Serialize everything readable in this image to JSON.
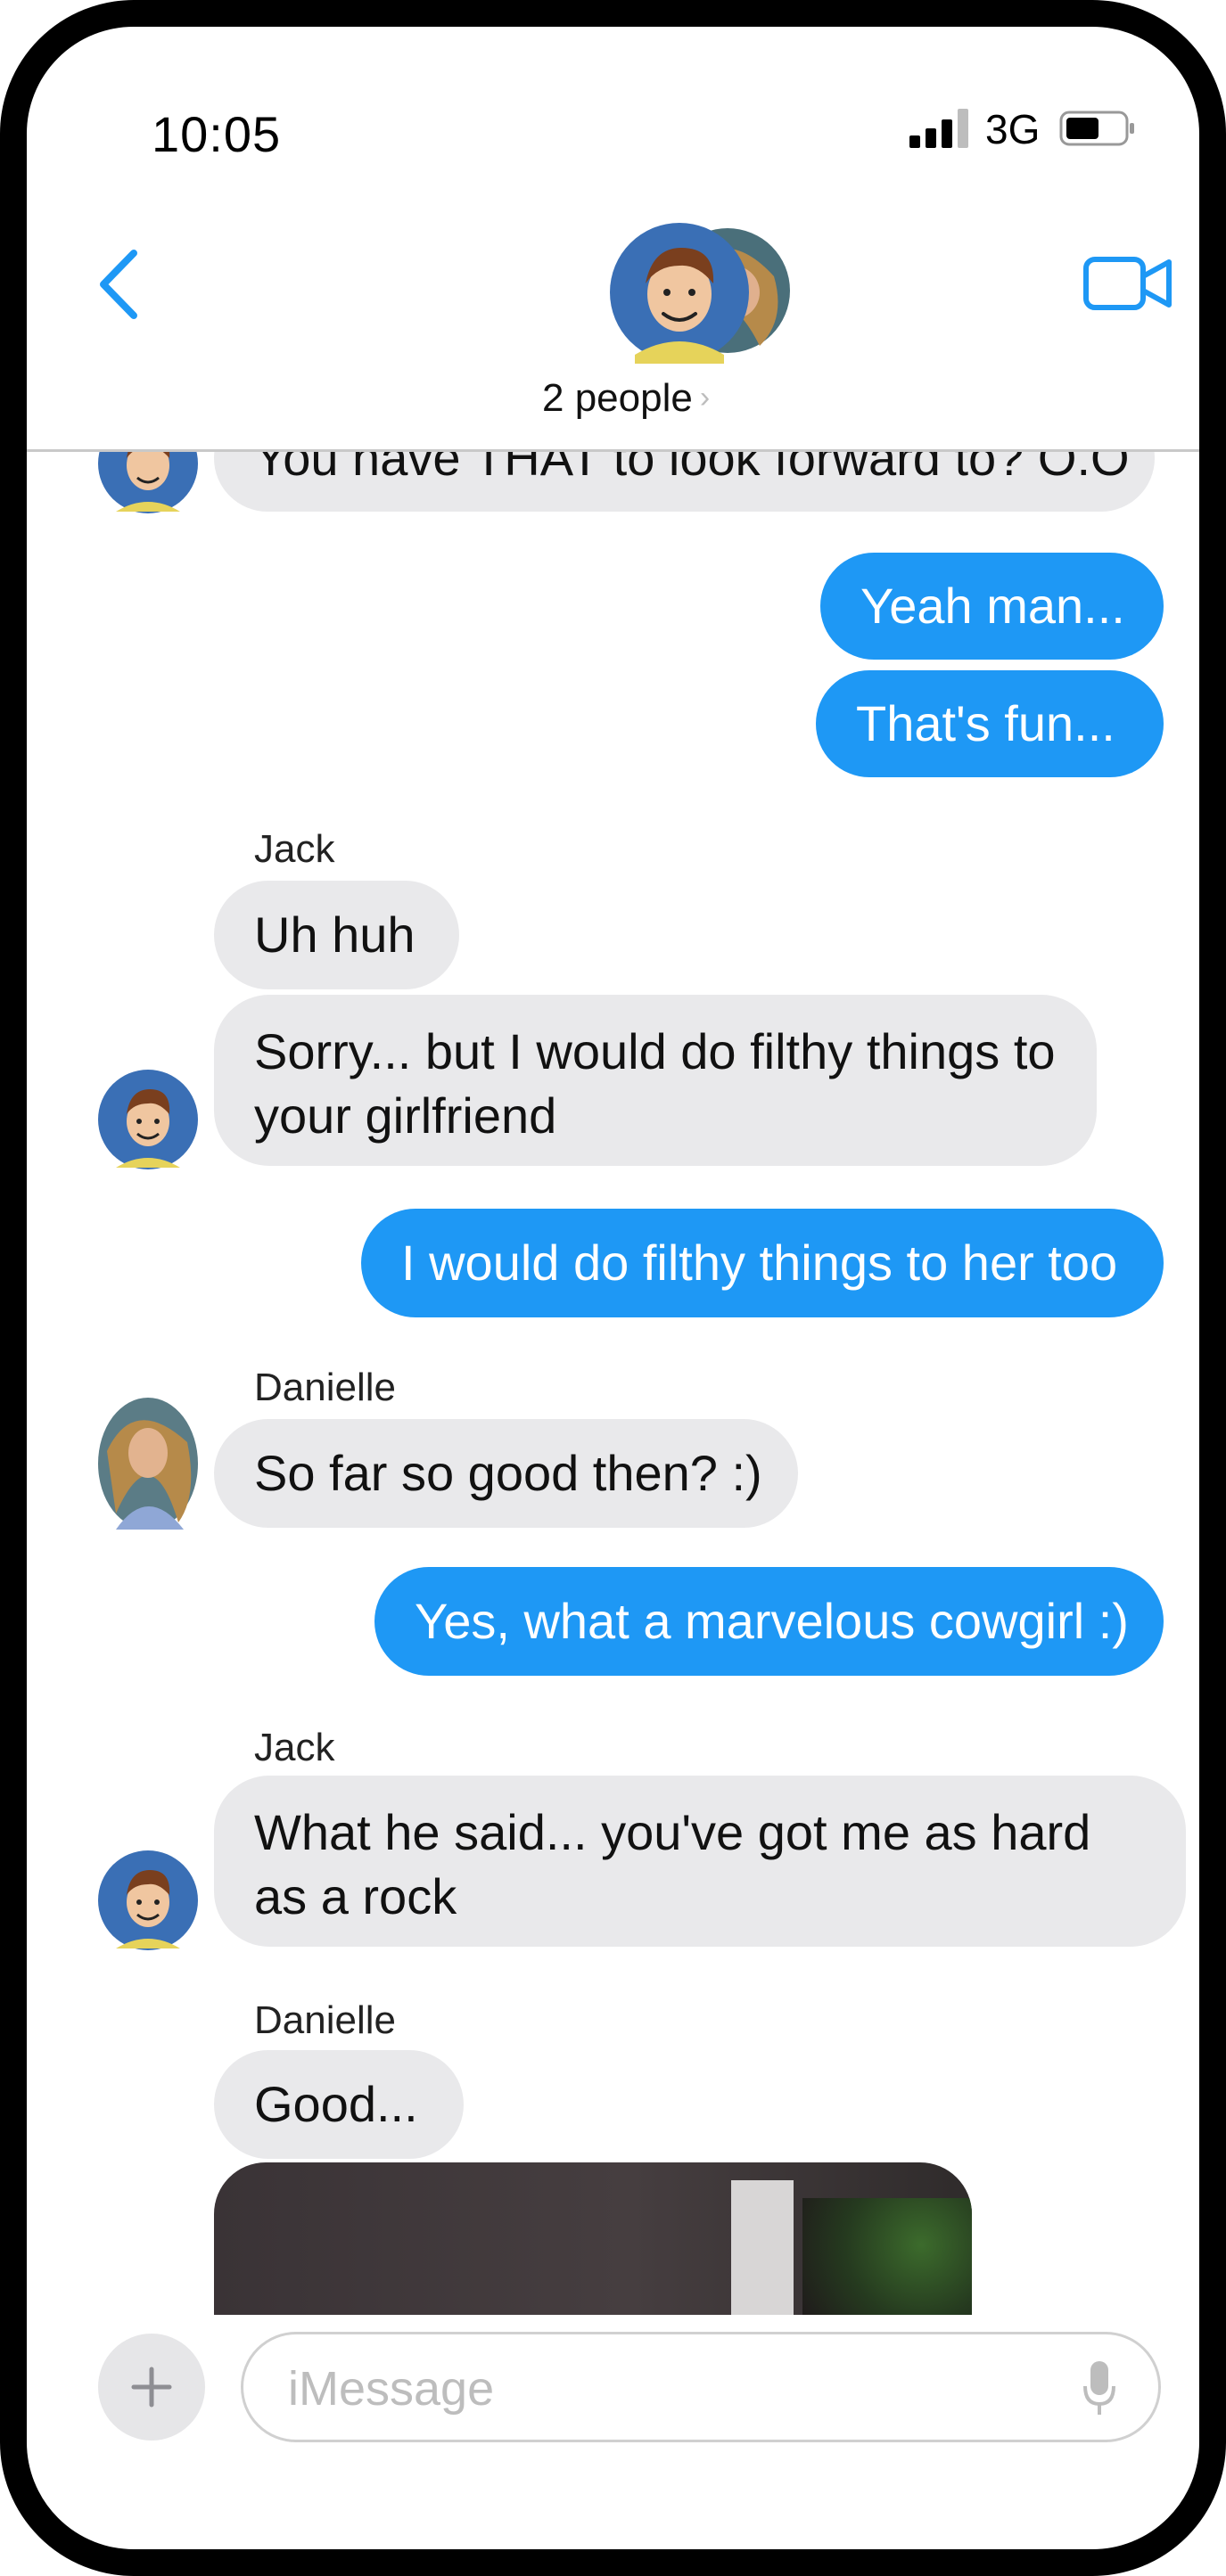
{
  "status_bar": {
    "time": "10:05",
    "network": "3G"
  },
  "header": {
    "people_label": "2 people",
    "chevron": "›"
  },
  "messages": [
    {
      "dir": "in",
      "sender": "",
      "text": "You have THAT to look forward to? O.O"
    },
    {
      "dir": "out",
      "text": "Yeah man..."
    },
    {
      "dir": "out",
      "text": "That's fun..."
    },
    {
      "dir": "in",
      "sender": "Jack",
      "text": "Uh huh"
    },
    {
      "dir": "in",
      "sender": "",
      "text": "Sorry... but I would do filthy things to your girlfriend"
    },
    {
      "dir": "out",
      "text": "I would do filthy things to her too"
    },
    {
      "dir": "in",
      "sender": "Danielle",
      "text": "So far so good then? :)"
    },
    {
      "dir": "out",
      "text": "Yes, what a marvelous cowgirl :)"
    },
    {
      "dir": "in",
      "sender": "Jack",
      "text": "What he said... you've got me as hard as a rock"
    },
    {
      "dir": "in",
      "sender": "Danielle",
      "text": "Good..."
    }
  ],
  "composer": {
    "placeholder": "iMessage"
  },
  "icons": {
    "back": "chevron-left-icon",
    "video": "video-camera-icon",
    "add": "plus-icon",
    "mic": "microphone-icon"
  },
  "colors": {
    "accent": "#1e98f5",
    "incoming_bubble": "#e9e9eb"
  }
}
